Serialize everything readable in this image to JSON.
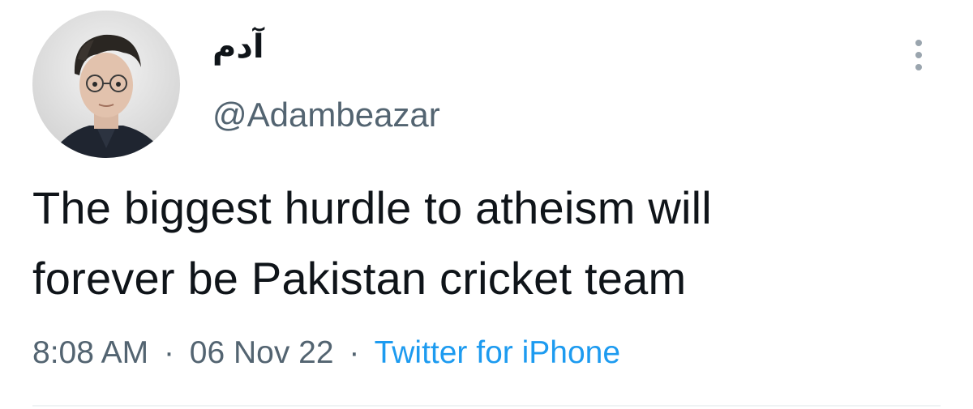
{
  "author": {
    "display_name": "آدم",
    "handle": "@Adambeazar",
    "avatar_icon": "profile-photo-icon"
  },
  "more_menu_icon": "more-vertical-icon",
  "tweet": {
    "text_line_1": "The biggest hurdle to atheism will",
    "text_line_2": "forever be Pakistan cricket team"
  },
  "meta": {
    "time": "8:08 AM",
    "separator": "·",
    "date": "06 Nov 22",
    "source": "Twitter for iPhone"
  },
  "colors": {
    "text": "#0f1419",
    "secondary": "#536471",
    "link": "#1d9bf0"
  }
}
